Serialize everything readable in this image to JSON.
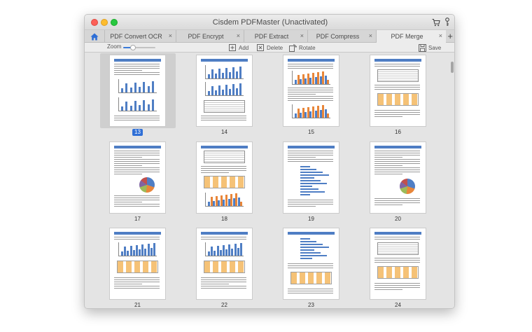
{
  "window": {
    "title": "Cisdem PDFMaster (Unactivated)"
  },
  "tabs": [
    {
      "label": "PDF Convert OCR",
      "active": false
    },
    {
      "label": "PDF Encrypt",
      "active": false
    },
    {
      "label": "PDF Extract",
      "active": false
    },
    {
      "label": "PDF Compress",
      "active": false
    },
    {
      "label": "PDF Merge",
      "active": true
    }
  ],
  "tab_close_glyph": "×",
  "add_tab_glyph": "+",
  "toolbar": {
    "zoom_label": "Zoom",
    "zoom_level": 0.3,
    "add_label": "Add",
    "delete_label": "Delete",
    "rotate_label": "Rotate",
    "save_label": "Save"
  },
  "pages": [
    {
      "number": "13",
      "selected": true,
      "style": "charts"
    },
    {
      "number": "14",
      "selected": false,
      "style": "charts-table"
    },
    {
      "number": "15",
      "selected": false,
      "style": "bars"
    },
    {
      "number": "16",
      "selected": false,
      "style": "tables"
    },
    {
      "number": "17",
      "selected": false,
      "style": "text-pie"
    },
    {
      "number": "18",
      "selected": false,
      "style": "table-bars"
    },
    {
      "number": "19",
      "selected": false,
      "style": "hbars"
    },
    {
      "number": "20",
      "selected": false,
      "style": "pie"
    },
    {
      "number": "21",
      "selected": false,
      "style": "bars-table"
    },
    {
      "number": "22",
      "selected": false,
      "style": "bars-table"
    },
    {
      "number": "23",
      "selected": false,
      "style": "hbars-table"
    },
    {
      "number": "24",
      "selected": false,
      "style": "tables"
    }
  ],
  "colors": {
    "accent": "#2f6fd6",
    "doc_header": "#4f7ec4",
    "highlight_orange": "#f4b860"
  },
  "icons": [
    "home-icon",
    "cart-icon",
    "key-icon",
    "add-icon",
    "delete-icon",
    "rotate-icon",
    "save-icon"
  ]
}
